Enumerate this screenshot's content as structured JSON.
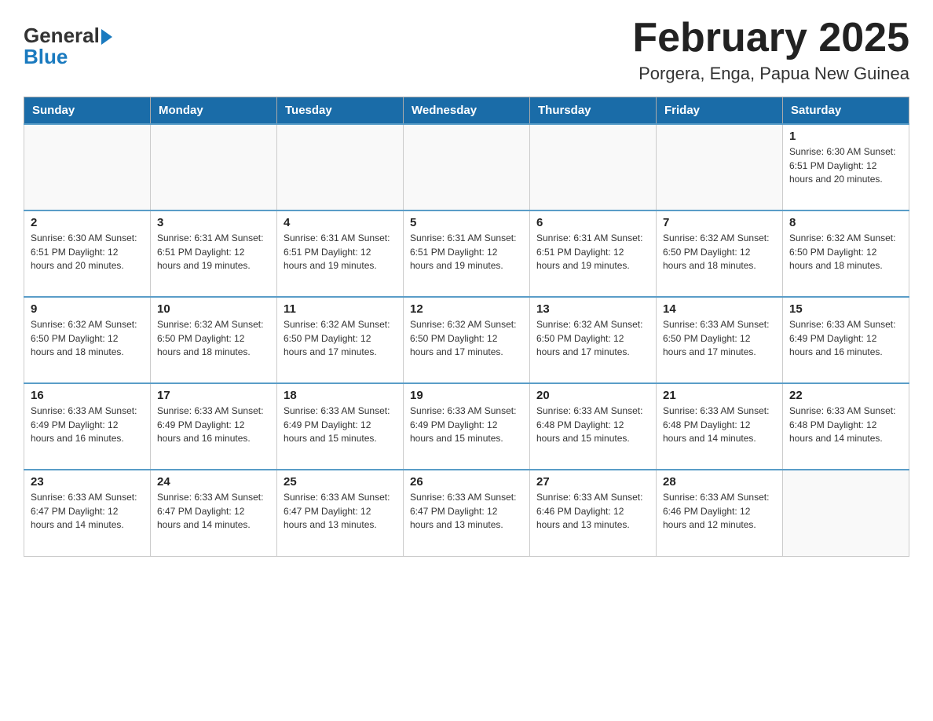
{
  "logo": {
    "general": "General",
    "blue": "Blue"
  },
  "header": {
    "month": "February 2025",
    "location": "Porgera, Enga, Papua New Guinea"
  },
  "days_of_week": [
    "Sunday",
    "Monday",
    "Tuesday",
    "Wednesday",
    "Thursday",
    "Friday",
    "Saturday"
  ],
  "weeks": [
    [
      {
        "day": "",
        "info": ""
      },
      {
        "day": "",
        "info": ""
      },
      {
        "day": "",
        "info": ""
      },
      {
        "day": "",
        "info": ""
      },
      {
        "day": "",
        "info": ""
      },
      {
        "day": "",
        "info": ""
      },
      {
        "day": "1",
        "info": "Sunrise: 6:30 AM\nSunset: 6:51 PM\nDaylight: 12 hours\nand 20 minutes."
      }
    ],
    [
      {
        "day": "2",
        "info": "Sunrise: 6:30 AM\nSunset: 6:51 PM\nDaylight: 12 hours\nand 20 minutes."
      },
      {
        "day": "3",
        "info": "Sunrise: 6:31 AM\nSunset: 6:51 PM\nDaylight: 12 hours\nand 19 minutes."
      },
      {
        "day": "4",
        "info": "Sunrise: 6:31 AM\nSunset: 6:51 PM\nDaylight: 12 hours\nand 19 minutes."
      },
      {
        "day": "5",
        "info": "Sunrise: 6:31 AM\nSunset: 6:51 PM\nDaylight: 12 hours\nand 19 minutes."
      },
      {
        "day": "6",
        "info": "Sunrise: 6:31 AM\nSunset: 6:51 PM\nDaylight: 12 hours\nand 19 minutes."
      },
      {
        "day": "7",
        "info": "Sunrise: 6:32 AM\nSunset: 6:50 PM\nDaylight: 12 hours\nand 18 minutes."
      },
      {
        "day": "8",
        "info": "Sunrise: 6:32 AM\nSunset: 6:50 PM\nDaylight: 12 hours\nand 18 minutes."
      }
    ],
    [
      {
        "day": "9",
        "info": "Sunrise: 6:32 AM\nSunset: 6:50 PM\nDaylight: 12 hours\nand 18 minutes."
      },
      {
        "day": "10",
        "info": "Sunrise: 6:32 AM\nSunset: 6:50 PM\nDaylight: 12 hours\nand 18 minutes."
      },
      {
        "day": "11",
        "info": "Sunrise: 6:32 AM\nSunset: 6:50 PM\nDaylight: 12 hours\nand 17 minutes."
      },
      {
        "day": "12",
        "info": "Sunrise: 6:32 AM\nSunset: 6:50 PM\nDaylight: 12 hours\nand 17 minutes."
      },
      {
        "day": "13",
        "info": "Sunrise: 6:32 AM\nSunset: 6:50 PM\nDaylight: 12 hours\nand 17 minutes."
      },
      {
        "day": "14",
        "info": "Sunrise: 6:33 AM\nSunset: 6:50 PM\nDaylight: 12 hours\nand 17 minutes."
      },
      {
        "day": "15",
        "info": "Sunrise: 6:33 AM\nSunset: 6:49 PM\nDaylight: 12 hours\nand 16 minutes."
      }
    ],
    [
      {
        "day": "16",
        "info": "Sunrise: 6:33 AM\nSunset: 6:49 PM\nDaylight: 12 hours\nand 16 minutes."
      },
      {
        "day": "17",
        "info": "Sunrise: 6:33 AM\nSunset: 6:49 PM\nDaylight: 12 hours\nand 16 minutes."
      },
      {
        "day": "18",
        "info": "Sunrise: 6:33 AM\nSunset: 6:49 PM\nDaylight: 12 hours\nand 15 minutes."
      },
      {
        "day": "19",
        "info": "Sunrise: 6:33 AM\nSunset: 6:49 PM\nDaylight: 12 hours\nand 15 minutes."
      },
      {
        "day": "20",
        "info": "Sunrise: 6:33 AM\nSunset: 6:48 PM\nDaylight: 12 hours\nand 15 minutes."
      },
      {
        "day": "21",
        "info": "Sunrise: 6:33 AM\nSunset: 6:48 PM\nDaylight: 12 hours\nand 14 minutes."
      },
      {
        "day": "22",
        "info": "Sunrise: 6:33 AM\nSunset: 6:48 PM\nDaylight: 12 hours\nand 14 minutes."
      }
    ],
    [
      {
        "day": "23",
        "info": "Sunrise: 6:33 AM\nSunset: 6:47 PM\nDaylight: 12 hours\nand 14 minutes."
      },
      {
        "day": "24",
        "info": "Sunrise: 6:33 AM\nSunset: 6:47 PM\nDaylight: 12 hours\nand 14 minutes."
      },
      {
        "day": "25",
        "info": "Sunrise: 6:33 AM\nSunset: 6:47 PM\nDaylight: 12 hours\nand 13 minutes."
      },
      {
        "day": "26",
        "info": "Sunrise: 6:33 AM\nSunset: 6:47 PM\nDaylight: 12 hours\nand 13 minutes."
      },
      {
        "day": "27",
        "info": "Sunrise: 6:33 AM\nSunset: 6:46 PM\nDaylight: 12 hours\nand 13 minutes."
      },
      {
        "day": "28",
        "info": "Sunrise: 6:33 AM\nSunset: 6:46 PM\nDaylight: 12 hours\nand 12 minutes."
      },
      {
        "day": "",
        "info": ""
      }
    ]
  ]
}
